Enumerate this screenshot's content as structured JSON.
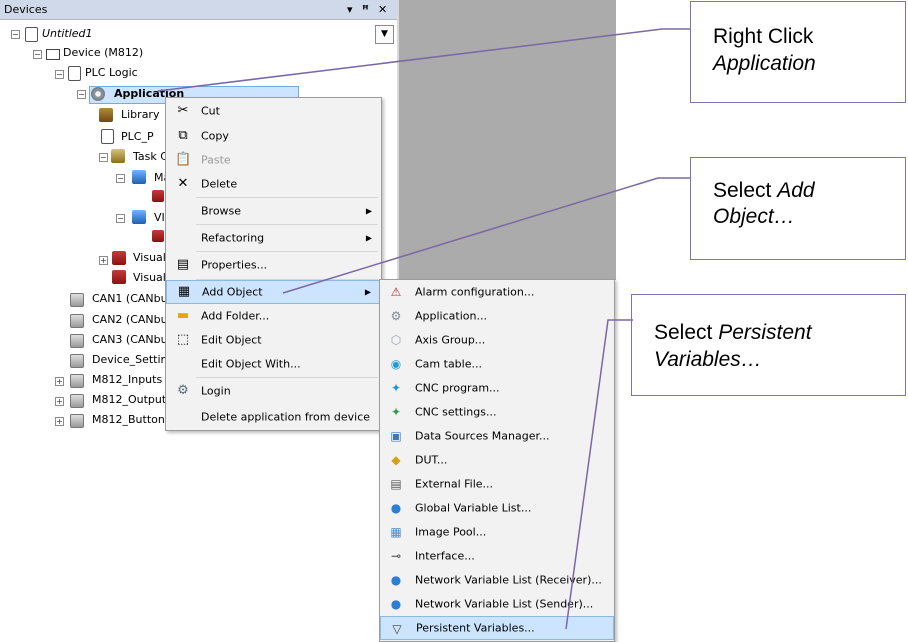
{
  "panel": {
    "title": "Devices",
    "controls": {
      "dropdown": "▾",
      "pin": "ᵖ",
      "close": "✕"
    }
  },
  "tree": {
    "untitled": "Untitled1",
    "device": "Device (M812)",
    "plc_logic": "PLC Logic",
    "application": "Application",
    "library": "Library",
    "plc_prg": "PLC_P",
    "task_config": "Task C",
    "main_task": "Ma",
    "visu_task": "VI",
    "visualization1": "Visuali:",
    "visualization2": "Visuali:",
    "can1": "CAN1 (CANbus",
    "can2": "CAN2 (CANbus",
    "can3": "CAN3 (CANbus",
    "device_settings": "Device_Setting",
    "inputs": "M812_Inputs (",
    "outputs": "M812_Outputs",
    "buttons": "M812_Buttons"
  },
  "context_menu": {
    "cut": "Cut",
    "copy": "Copy",
    "paste": "Paste",
    "delete": "Delete",
    "browse": "Browse",
    "refactoring": "Refactoring",
    "properties": "Properties...",
    "add_object": "Add Object",
    "add_folder": "Add Folder...",
    "edit_object": "Edit Object",
    "edit_object_with": "Edit Object With...",
    "login": "Login",
    "delete_app": "Delete application from device"
  },
  "submenu": [
    {
      "label": "Alarm configuration...",
      "icon": "alarm-icon",
      "color": "#c62828"
    },
    {
      "label": "Application...",
      "icon": "application-icon",
      "color": "#7d8893"
    },
    {
      "label": "Axis Group...",
      "icon": "axis-group-icon",
      "color": "#9aa3ab"
    },
    {
      "label": "Cam table...",
      "icon": "cam-table-icon",
      "color": "#1e9bd7"
    },
    {
      "label": "CNC program...",
      "icon": "cnc-program-icon",
      "color": "#1e9bd7"
    },
    {
      "label": "CNC settings...",
      "icon": "cnc-settings-icon",
      "color": "#2e9e4d"
    },
    {
      "label": "Data Sources Manager...",
      "icon": "data-sources-icon",
      "color": "#3a78c2"
    },
    {
      "label": "DUT...",
      "icon": "dut-icon",
      "color": "#d4a017"
    },
    {
      "label": "External File...",
      "icon": "external-file-icon",
      "color": "#5b5b5b"
    },
    {
      "label": "Global Variable List...",
      "icon": "global-variable-list-icon",
      "color": "#2a7fd4"
    },
    {
      "label": "Image Pool...",
      "icon": "image-pool-icon",
      "color": "#4a8bd0"
    },
    {
      "label": "Interface...",
      "icon": "interface-icon",
      "color": "#444444"
    },
    {
      "label": "Network Variable List (Receiver)...",
      "icon": "nvl-receiver-icon",
      "color": "#2a7fd4"
    },
    {
      "label": "Network Variable List (Sender)...",
      "icon": "nvl-sender-icon",
      "color": "#2a7fd4"
    },
    {
      "label": "Persistent Variables...",
      "icon": "persistent-variables-icon",
      "color": "#444444"
    }
  ],
  "callouts": {
    "c1_line1": "Right Click",
    "c1_line2": "Application",
    "c2_line1_a": "Select ",
    "c2_line1_b": "Add",
    "c2_line2": "Object…",
    "c3_line1_a": "Select ",
    "c3_line1_b": "Persistent",
    "c3_line2": "Variables…"
  },
  "colors": {
    "selection": "#cce4ff",
    "callout_border": "#8073a6",
    "leader_line": "#7a68a6",
    "grey_area": "#ababab"
  }
}
